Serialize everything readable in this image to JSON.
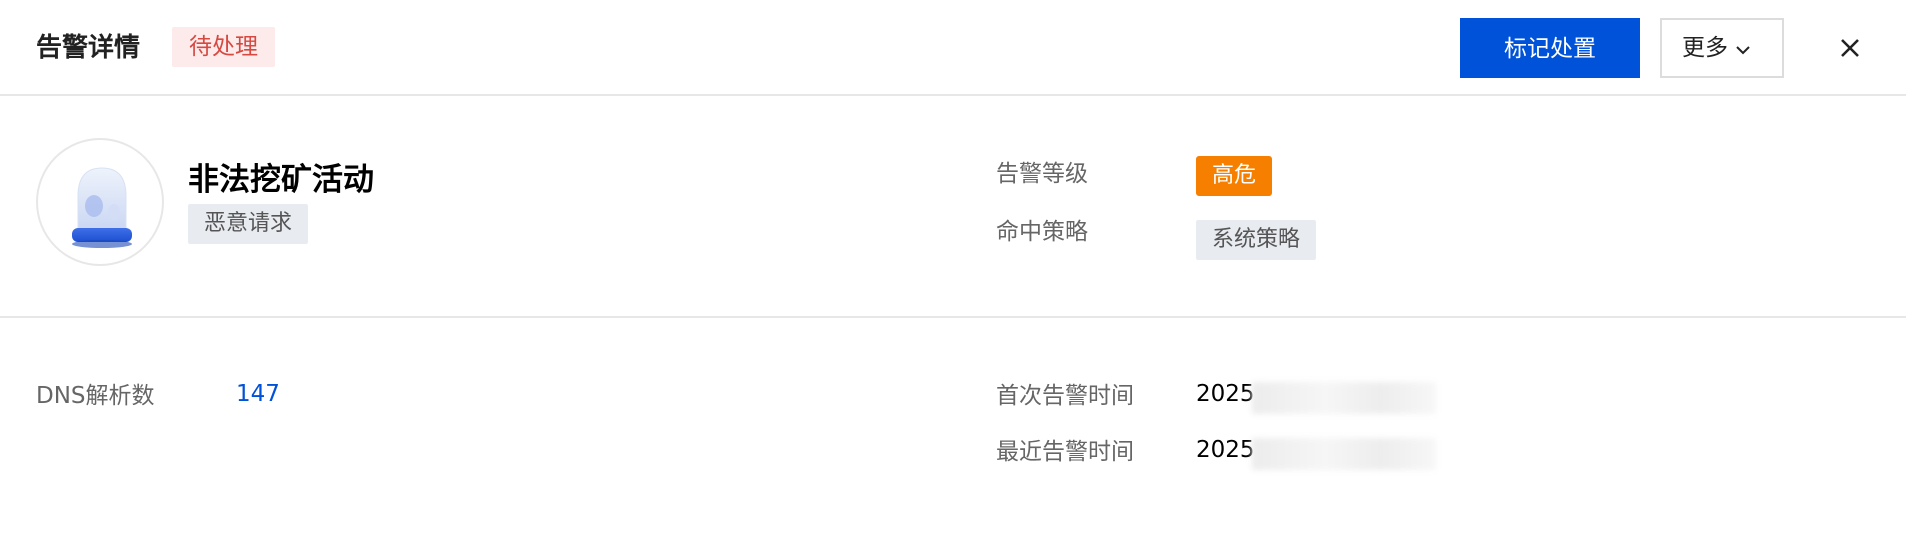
{
  "header": {
    "title": "告警详情",
    "status": "待处理",
    "primary_action": "标记处置",
    "more_label": "更多"
  },
  "summary": {
    "alert_name": "非法挖矿活动",
    "alert_type": "恶意请求",
    "fields": {
      "level_label": "告警等级",
      "level_value": "高危",
      "policy_label": "命中策略",
      "policy_value": "系统策略"
    }
  },
  "details": {
    "dns_label": "DNS解析数",
    "dns_value": "147",
    "first_time_label": "首次告警时间",
    "first_time_value": "2025",
    "last_time_label": "最近告警时间",
    "last_time_value": "2025"
  },
  "colors": {
    "primary": "#0052d9",
    "high_risk": "#f77f00",
    "pending_text": "#d54941",
    "pending_bg": "#fdeaea"
  },
  "icons": {
    "avatar": "alarm-siren-icon",
    "more": "chevron-down-icon",
    "close": "close-icon"
  }
}
